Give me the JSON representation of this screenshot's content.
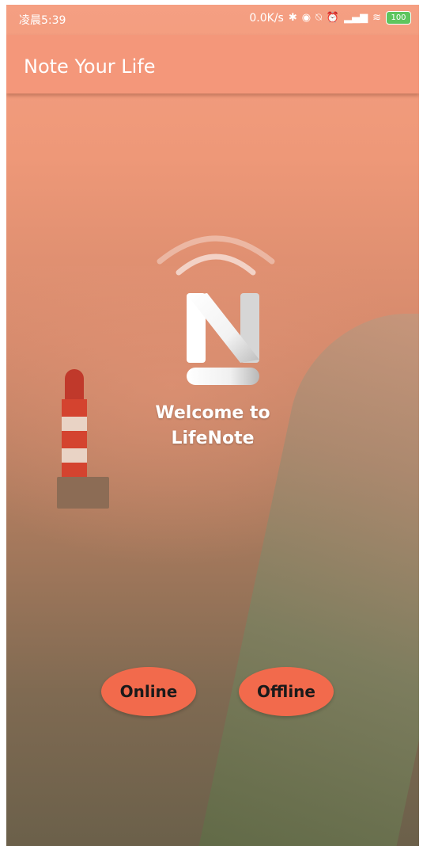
{
  "status_bar": {
    "time": "凌晨5:39",
    "network_speed": "0.0K/s",
    "battery": "100",
    "icons": [
      "bluetooth-icon",
      "eye-icon",
      "mute-icon",
      "alarm-icon",
      "signal-icon",
      "wifi-icon"
    ]
  },
  "app_bar": {
    "title": "Note Your Life"
  },
  "welcome": {
    "line1": "Welcome to",
    "line2": "LifeNote"
  },
  "buttons": {
    "online": "Online",
    "offline": "Offline"
  },
  "colors": {
    "app_bar": "#f4977a",
    "button": "#f26a4c",
    "battery": "#5ec55e"
  }
}
